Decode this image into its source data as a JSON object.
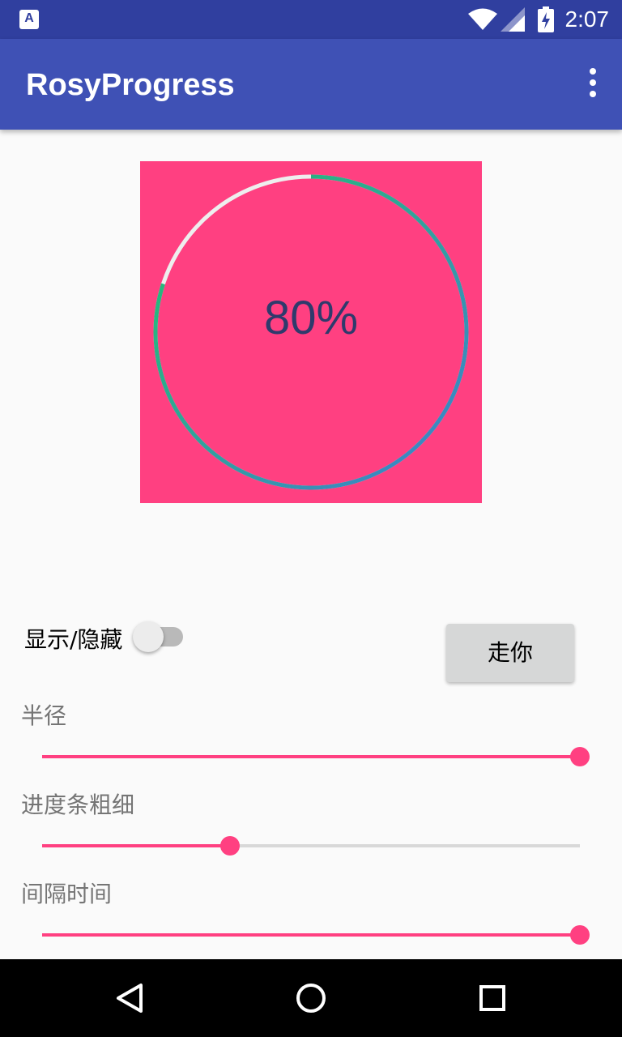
{
  "status_bar": {
    "app_icon": "A",
    "time": "2:07",
    "icons": [
      "wifi-icon",
      "signal-icon",
      "battery-charging-icon"
    ]
  },
  "app_bar": {
    "title": "RosyProgress",
    "menu_icon": "more-vert-icon"
  },
  "progress": {
    "text": "80%",
    "percent": 80,
    "background_color": "#ff4081",
    "track_color": "#eeeeee",
    "gradient_start": "#3f7fcf",
    "gradient_end": "#22c46a",
    "text_color": "#2f3a6c"
  },
  "controls": {
    "toggle_label": "显示/隐藏",
    "toggle_on": false,
    "button_label": "走你",
    "sliders": [
      {
        "label": "半径",
        "value": 1.0
      },
      {
        "label": "进度条粗细",
        "value": 0.35
      },
      {
        "label": "间隔时间",
        "value": 1.0
      }
    ]
  },
  "nav_bar": {
    "icons": [
      "back-icon",
      "home-icon",
      "recents-icon"
    ]
  },
  "colors": {
    "primary": "#3f51b5",
    "primary_dark": "#303f9f",
    "accent": "#ff4081"
  }
}
